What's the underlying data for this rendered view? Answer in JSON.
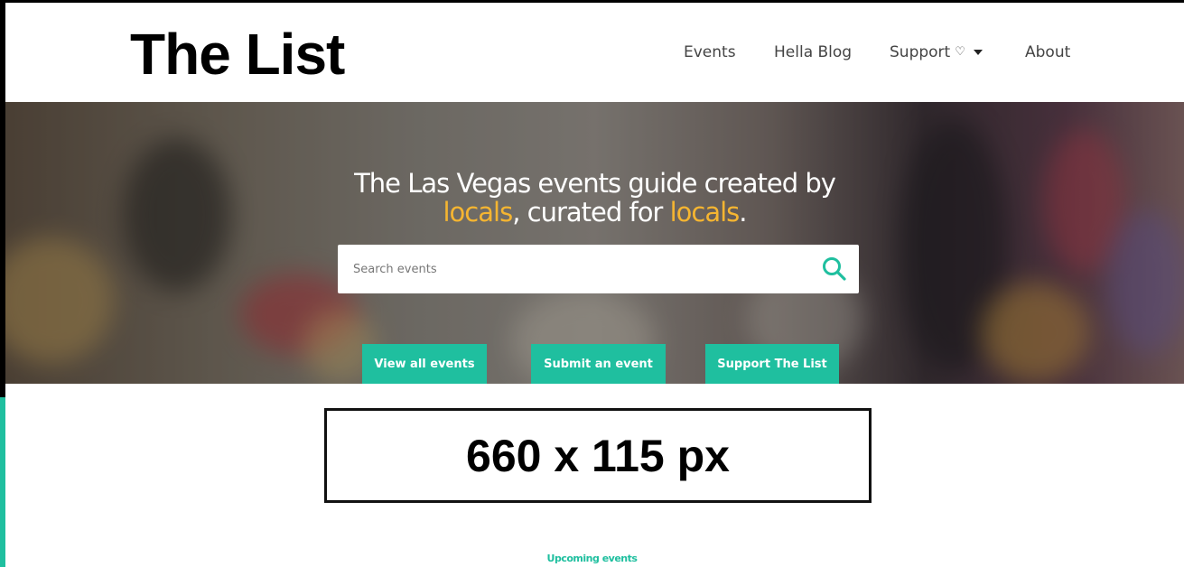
{
  "header": {
    "logo": "The List",
    "nav": {
      "events": "Events",
      "blog": "Hella Blog",
      "support": "Support",
      "about": "About"
    }
  },
  "hero": {
    "tagline_part1": "The Las Vegas events guide created by",
    "tagline_highlight1": "locals",
    "tagline_part2": ", curated for ",
    "tagline_highlight2": "locals",
    "tagline_part3": ".",
    "search_placeholder": "Search events",
    "buttons": {
      "view_all": "View all events",
      "submit": "Submit an event",
      "support": "Support The List"
    }
  },
  "ad_placeholder": "660 x 115 px",
  "section_label": "Upcoming events",
  "colors": {
    "accent": "#1fbf9f",
    "highlight": "#f5b531"
  },
  "icons": {
    "search": "search-icon",
    "heart": "heart-icon",
    "caret": "caret-down-icon"
  }
}
